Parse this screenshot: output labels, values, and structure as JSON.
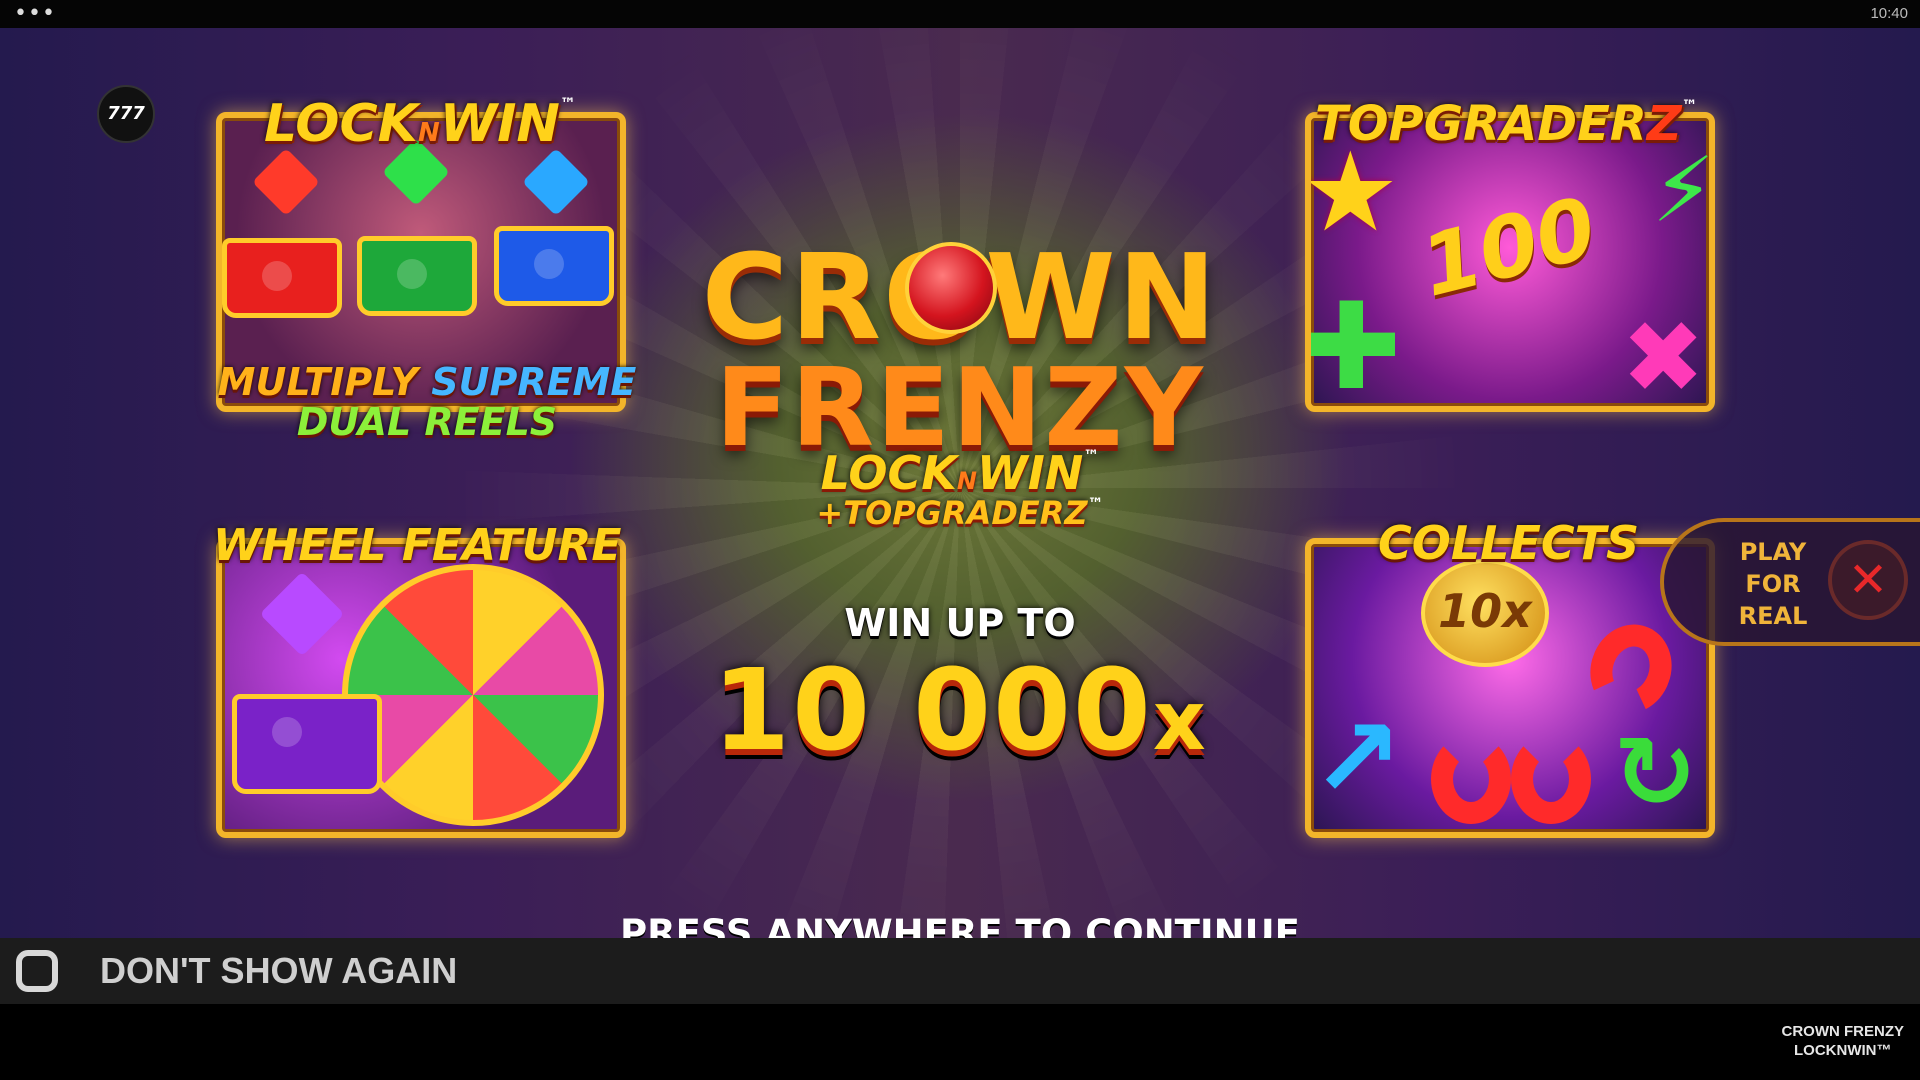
{
  "status_bar": {
    "menu_icon": "more-dots-icon",
    "menu_glyph": "•••",
    "time": "10:40"
  },
  "badge": {
    "label": "777"
  },
  "features": {
    "lock_n_win": {
      "title_a": "LOCK",
      "title_n": "N",
      "title_b": "WIN",
      "tm": "™",
      "line1_a": "MULTIPLY",
      "line1_b": "SUPREME",
      "line2": "DUAL REELS"
    },
    "top_graderz": {
      "title_a": "TOPGRADER",
      "title_z": "Z",
      "tm": "™",
      "value": "100"
    },
    "wheel": {
      "title": "WHEEL FEATURE"
    },
    "collects": {
      "title": "COLLECTS",
      "coin": "10x"
    }
  },
  "logo": {
    "line1": "CROWN",
    "line2": "FRENZY",
    "lock_a": "LOCK",
    "lock_n": "N",
    "lock_b": "WIN",
    "tm": "™",
    "sub": "+TOPGRADERZ",
    "sub_tm": "™"
  },
  "win": {
    "label": "WIN UP TO",
    "amount": "10 000",
    "suffix": "x"
  },
  "press_text": "PRESS ANYWHERE TO CONTINUE",
  "play_for_real": {
    "label": "PLAY FOR REAL",
    "close_icon": "close-icon",
    "close_glyph": "✕"
  },
  "dont_show": {
    "label": "DON'T SHOW AGAIN"
  },
  "footer": {
    "line1": "CROWN FRENZY",
    "line2": "LOCKNWIN™"
  },
  "colors": {
    "gold": "#ffd21a",
    "accent_red": "#e8282a",
    "panel_border": "#f3b52a"
  }
}
